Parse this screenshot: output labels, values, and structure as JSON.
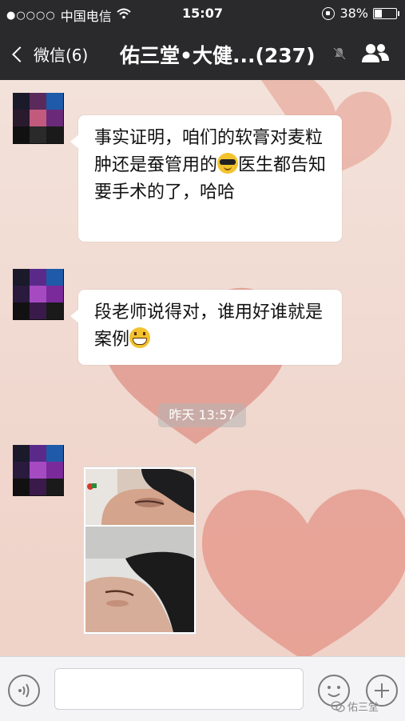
{
  "status_bar": {
    "signal": "●○○○○",
    "carrier": "中国电信",
    "time": "15:07",
    "battery": "38%",
    "battery_level": 0.38
  },
  "nav": {
    "back_label": "微信(6)",
    "title": "佑三堂•大健...(237)"
  },
  "messages": [
    {
      "text_parts": [
        "事实证明，咱们的软膏对麦粒肿还是蚕管用的",
        "医生都告知要手术的了，哈哈"
      ],
      "emoji": "sunglasses-emoji"
    },
    {
      "text_parts": [
        "段老师说得对，谁用好谁就是案例"
      ],
      "emoji": "grin-emoji"
    }
  ],
  "timestamp": "昨天 13:57",
  "watermark": "佑三堂",
  "colors": {
    "bar_dark": "#2a2a2c",
    "chat_bg": "#f2ddd5",
    "heart": "#e08a7c"
  }
}
